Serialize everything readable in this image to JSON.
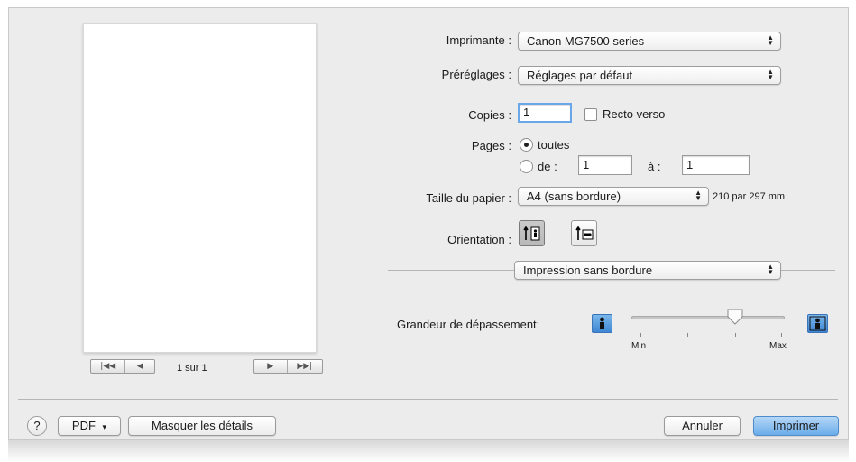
{
  "preview": {
    "page_label": "1 sur 1",
    "nav_back": [
      "|◀◀",
      "◀"
    ],
    "nav_forward": [
      "▶",
      "▶▶|"
    ]
  },
  "printer": {
    "label": "Imprimante :",
    "value": "Canon MG7500 series"
  },
  "presets": {
    "label": "Préréglages :",
    "value": "Réglages par défaut"
  },
  "copies": {
    "label": "Copies :",
    "value": "1",
    "duplex_label": "Recto verso",
    "duplex_checked": false
  },
  "pages": {
    "label": "Pages :",
    "all_label": "toutes",
    "range_label": "de :",
    "from": "1",
    "to_label": "à :",
    "to": "1",
    "selected": "all"
  },
  "paper_size": {
    "label": "Taille du papier :",
    "value": "A4 (sans bordure)",
    "dimensions": "210 par 297 mm"
  },
  "orientation": {
    "label": "Orientation :",
    "selected": "portrait"
  },
  "section": {
    "value": "Impression sans bordure"
  },
  "extension": {
    "label": "Grandeur de dépassement:",
    "min_label": "Min",
    "max_label": "Max",
    "level": 0.75
  },
  "footer": {
    "help_label": "?",
    "pdf_label": "PDF",
    "hide_details_label": "Masquer les détails",
    "cancel_label": "Annuler",
    "print_label": "Imprimer"
  }
}
